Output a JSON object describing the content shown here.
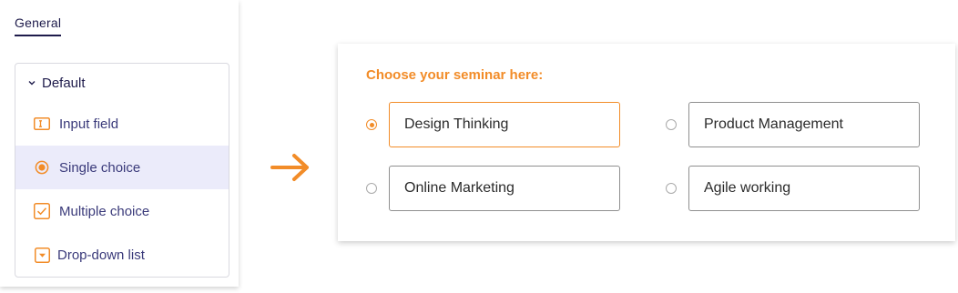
{
  "sidebar": {
    "tab_label": "General",
    "group_label": "Default",
    "items": [
      {
        "label": "Input field",
        "icon": "input-field-icon",
        "selected": false
      },
      {
        "label": "Single choice",
        "icon": "radio-icon",
        "selected": true
      },
      {
        "label": "Multiple choice",
        "icon": "checkbox-icon",
        "selected": false
      },
      {
        "label": "Drop-down list",
        "icon": "dropdown-icon",
        "selected": false
      }
    ]
  },
  "connector": {
    "icon": "arrow-right-icon"
  },
  "form": {
    "question": "Choose your seminar here:",
    "options": [
      {
        "label": "Design Thinking",
        "checked": true
      },
      {
        "label": "Product Management",
        "checked": false
      },
      {
        "label": "Online Marketing",
        "checked": false
      },
      {
        "label": "Agile working",
        "checked": false
      }
    ]
  },
  "colors": {
    "accent": "#f28c28",
    "navy": "#1e1b4b",
    "item_text": "#3a3a7a",
    "selected_bg": "#ebebfa"
  }
}
